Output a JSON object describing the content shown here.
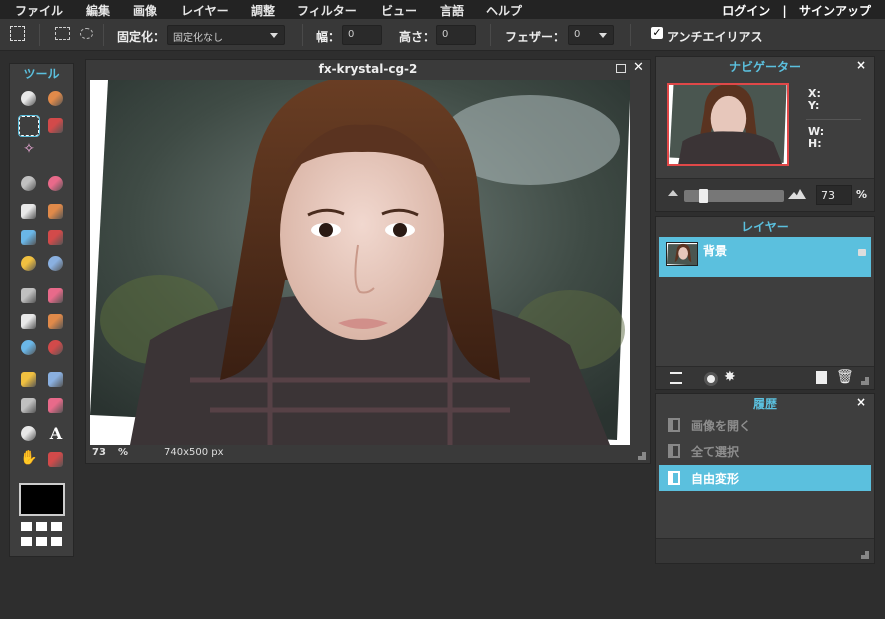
{
  "menu": {
    "items": [
      "ファイル",
      "編集",
      "画像",
      "レイヤー",
      "調整",
      "フィルター",
      "ビュー",
      "言語",
      "ヘルプ"
    ],
    "login": "ログイン",
    "divider": "|",
    "signup": "サインアップ"
  },
  "options": {
    "fixed_label": "固定化：",
    "fixed_value": "固定化なし",
    "width_label": "幅：",
    "width_value": "0",
    "height_label": "高さ：",
    "height_value": "0",
    "feather_label": "フェザー：",
    "feather_value": "0",
    "antialias_label": "アンチエイリアス",
    "antialias_checked": true
  },
  "tools": {
    "title": "ツール"
  },
  "canvas": {
    "title": "fx-krystal-cg-2",
    "zoom": "73",
    "zoom_unit": "%",
    "size": "740x500 px"
  },
  "navigator": {
    "title": "ナビゲーター",
    "x_label": "X:",
    "y_label": "Y:",
    "w_label": "W:",
    "h_label": "H:",
    "zoom_value": "73",
    "zoom_unit": "%"
  },
  "layers": {
    "title": "レイヤー",
    "items": [
      {
        "name": "背景",
        "locked": true
      }
    ]
  },
  "history": {
    "title": "履歴",
    "items": [
      {
        "label": "画像を開く",
        "active": false
      },
      {
        "label": "全て選択",
        "active": false
      },
      {
        "label": "自由変形",
        "active": true
      }
    ]
  },
  "colors": {
    "accent": "#5bc0de",
    "menubar": "#232323",
    "panel": "#3e3e3e",
    "background": "#2e2e2e"
  }
}
